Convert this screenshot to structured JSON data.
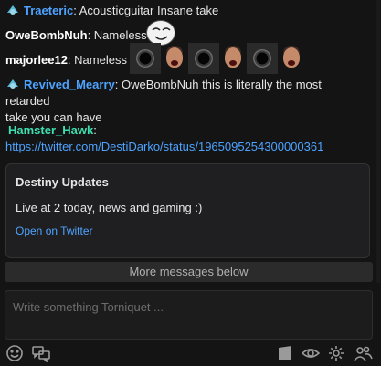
{
  "messages": [
    {
      "user": "Traeteric",
      "text": ": Acousticguitar Insane take"
    },
    {
      "user": "OweBombNuh",
      "text": ": Nameless"
    },
    {
      "user": "majorlee12",
      "text": ": Nameless"
    },
    {
      "user": "Revived_Mearry",
      "text": ": OweBombNuh this is literally the most retarded",
      "text2": "take you can have"
    },
    {
      "user": "Hamster_Hawk",
      "text": ":",
      "link": "https://twitter.com/DestiDarko/status/1965095254300000361"
    }
  ],
  "embed": {
    "title": "Destiny Updates",
    "text": "Live at 2 today, news and gaming :)",
    "link_label": "Open on Twitter"
  },
  "more_messages": "More messages below",
  "composer": {
    "placeholder": "Write something Torniquet ..."
  },
  "icons": [
    "emoji-icon",
    "whispers-icon",
    "clapperboard-icon",
    "eye-icon",
    "gear-icon",
    "users-icon"
  ]
}
